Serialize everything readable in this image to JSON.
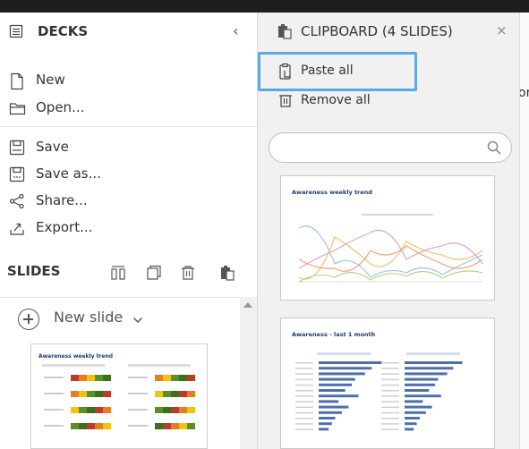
{
  "decks": {
    "title": "DECKS",
    "collapse_glyph": "‹",
    "menu": [
      {
        "label": "New",
        "icon": "new-file-icon"
      },
      {
        "label": "Open...",
        "icon": "folder-open-icon"
      },
      {
        "label": "Save",
        "icon": "save-icon"
      },
      {
        "label": "Save as...",
        "icon": "save-as-icon"
      },
      {
        "label": "Share...",
        "icon": "share-icon"
      },
      {
        "label": "Export...",
        "icon": "export-icon"
      }
    ]
  },
  "slides": {
    "title": "SLIDES",
    "new_slide_label": "New slide",
    "thumbnail_title": "Awareness weekly trend"
  },
  "clipboard": {
    "title": "CLIPBOARD (4 SLIDES)",
    "close_glyph": "×",
    "paste_all_label": "Paste all",
    "remove_all_label": "Remove all",
    "search_placeholder": "",
    "items": [
      {
        "title": "Awareness weekly trend"
      },
      {
        "title": "Awareness  - last 1 month"
      }
    ]
  },
  "right_strip": {
    "text_fragment": "or"
  },
  "colors": {
    "focus_outline": "#5aa9df",
    "panel_bg": "#f1f1f1",
    "topbar": "#1e1e1e",
    "chart_title": "#1f3a6b",
    "line_series": [
      "#9ec3e6",
      "#f4c16e",
      "#d9a5c9",
      "#f7a37a",
      "#b9d28c"
    ],
    "bar_series": "#4e6fae",
    "heat_colors": [
      "#c0392b",
      "#e67e22",
      "#f1c40f",
      "#5a8f29",
      "#3e6d1c"
    ]
  }
}
